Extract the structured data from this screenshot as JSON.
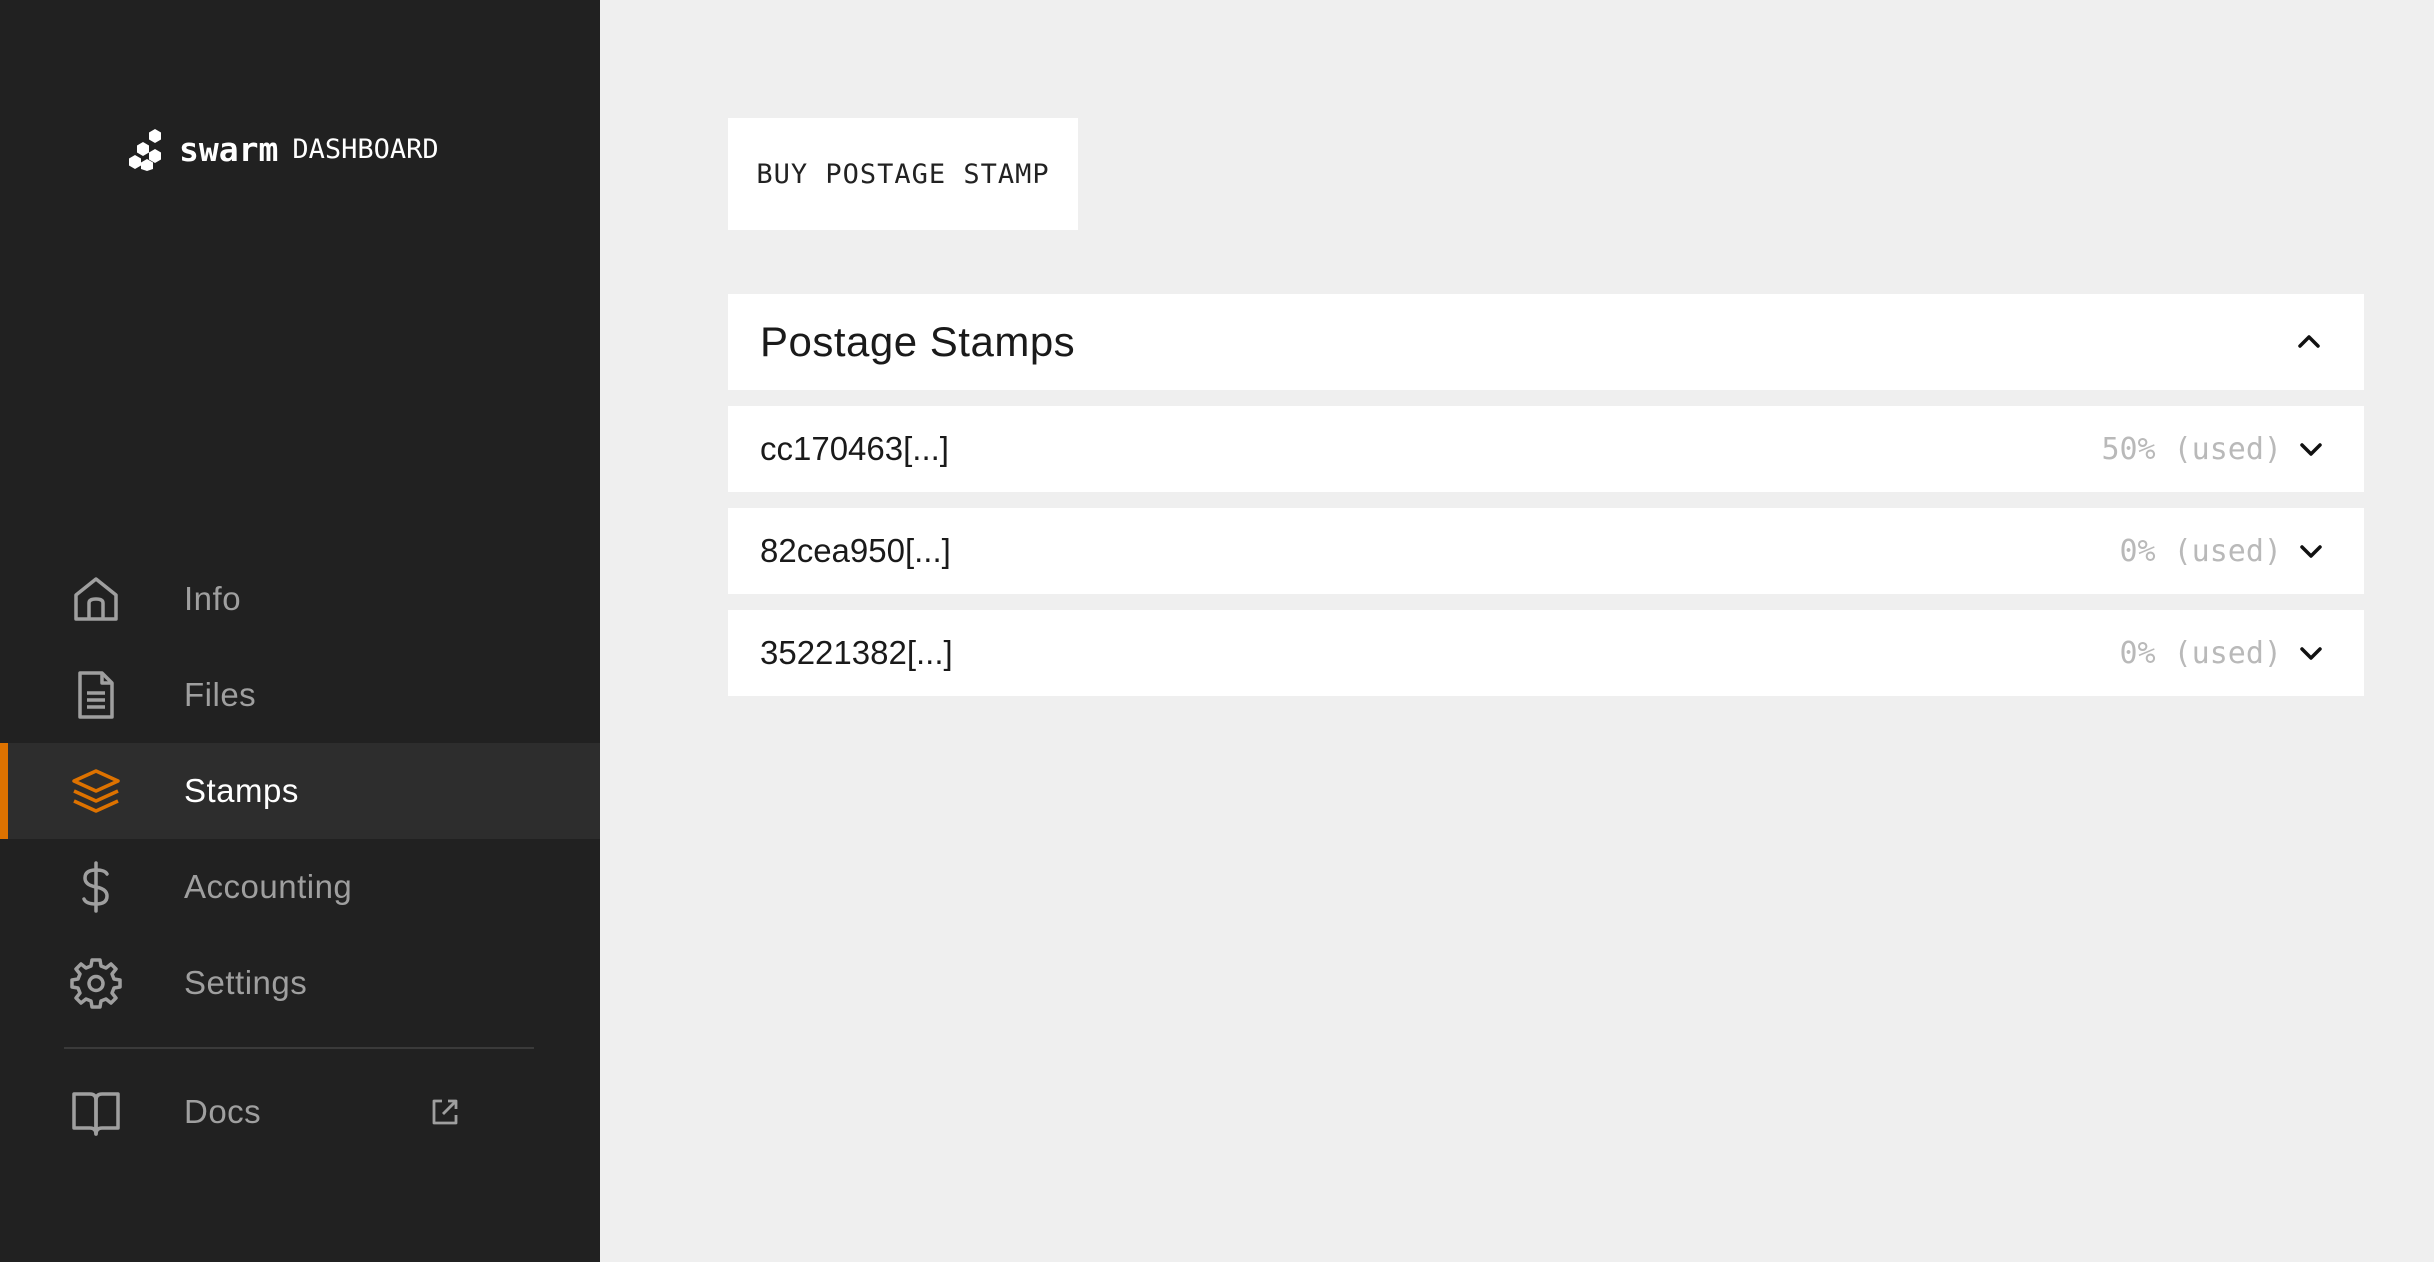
{
  "brand": {
    "wordmark": "swarm",
    "subtitle": "DASHBOARD"
  },
  "sidebar": {
    "items": [
      {
        "label": "Info",
        "icon": "home-icon",
        "active": false
      },
      {
        "label": "Files",
        "icon": "file-icon",
        "active": false
      },
      {
        "label": "Stamps",
        "icon": "layers-icon",
        "active": true
      },
      {
        "label": "Accounting",
        "icon": "dollar-icon",
        "active": false
      },
      {
        "label": "Settings",
        "icon": "gear-icon",
        "active": false
      }
    ],
    "docs": {
      "label": "Docs",
      "icon": "book-icon",
      "external_icon": "external-link-icon"
    }
  },
  "colors": {
    "accent": "#dd7200",
    "sidebar_bg": "#212121",
    "main_bg": "#efefef"
  },
  "main": {
    "buy_button_label": "BUY POSTAGE STAMP",
    "panel": {
      "title": "Postage Stamps",
      "expanded": true
    },
    "stamps": [
      {
        "id": "cc170463[...]",
        "usage_percent": "50%",
        "usage_suffix": "(used)"
      },
      {
        "id": "82cea950[...]",
        "usage_percent": "0%",
        "usage_suffix": "(used)"
      },
      {
        "id": "35221382[...]",
        "usage_percent": "0%",
        "usage_suffix": "(used)"
      }
    ]
  }
}
